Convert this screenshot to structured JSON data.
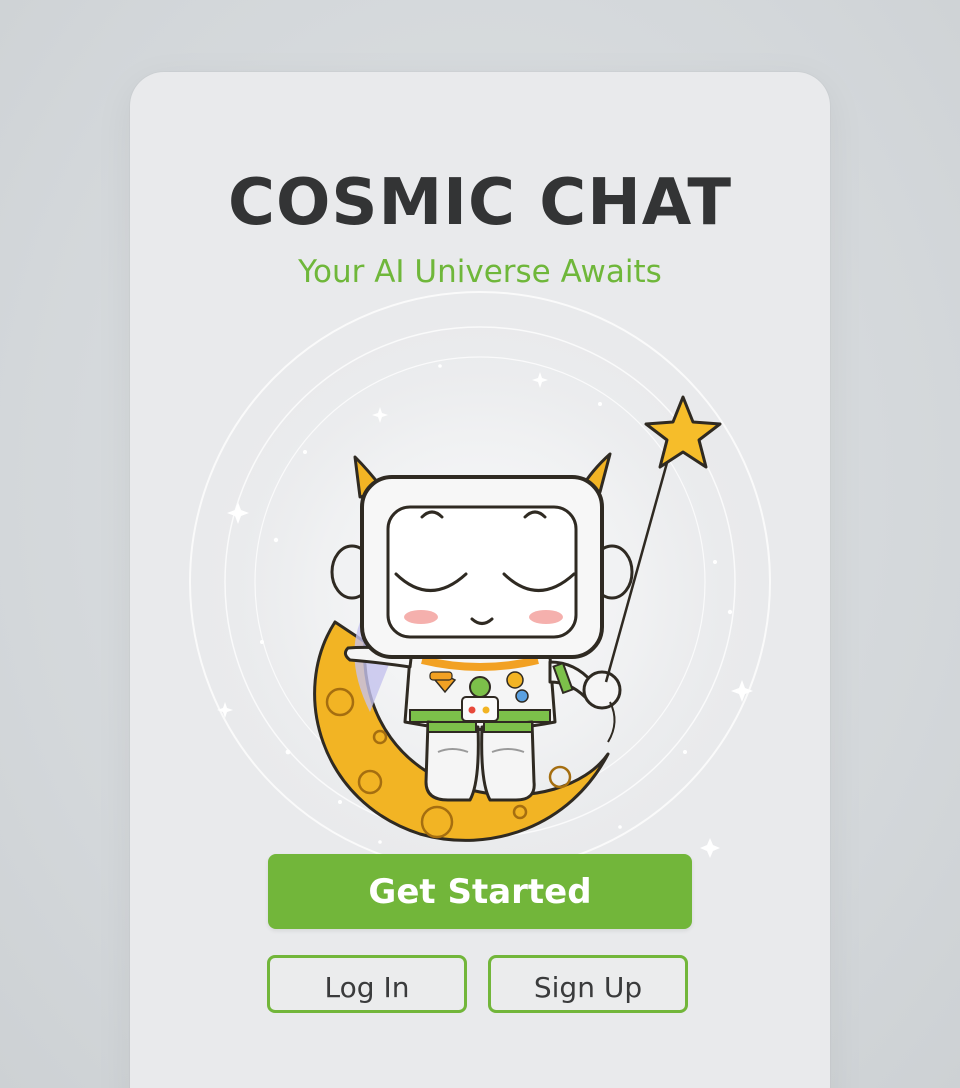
{
  "app": {
    "title": "COSMIC CHAT",
    "tagline": "Your AI Universe Awaits"
  },
  "illustration": {
    "subject": "robot-astronaut-on-moon",
    "icon_names": [
      "robot-mascot-icon",
      "crescent-moon-icon",
      "star-wand-icon",
      "sparkle-icon"
    ]
  },
  "actions": {
    "primary_label": "Get Started",
    "login_label": "Log In",
    "signup_label": "Sign Up"
  },
  "colors": {
    "accent": "#72b63a",
    "title": "#333435",
    "card": "#e9eaec",
    "background": "#d4d8db",
    "moon": "#f2b424",
    "star": "#f6bd2a"
  }
}
